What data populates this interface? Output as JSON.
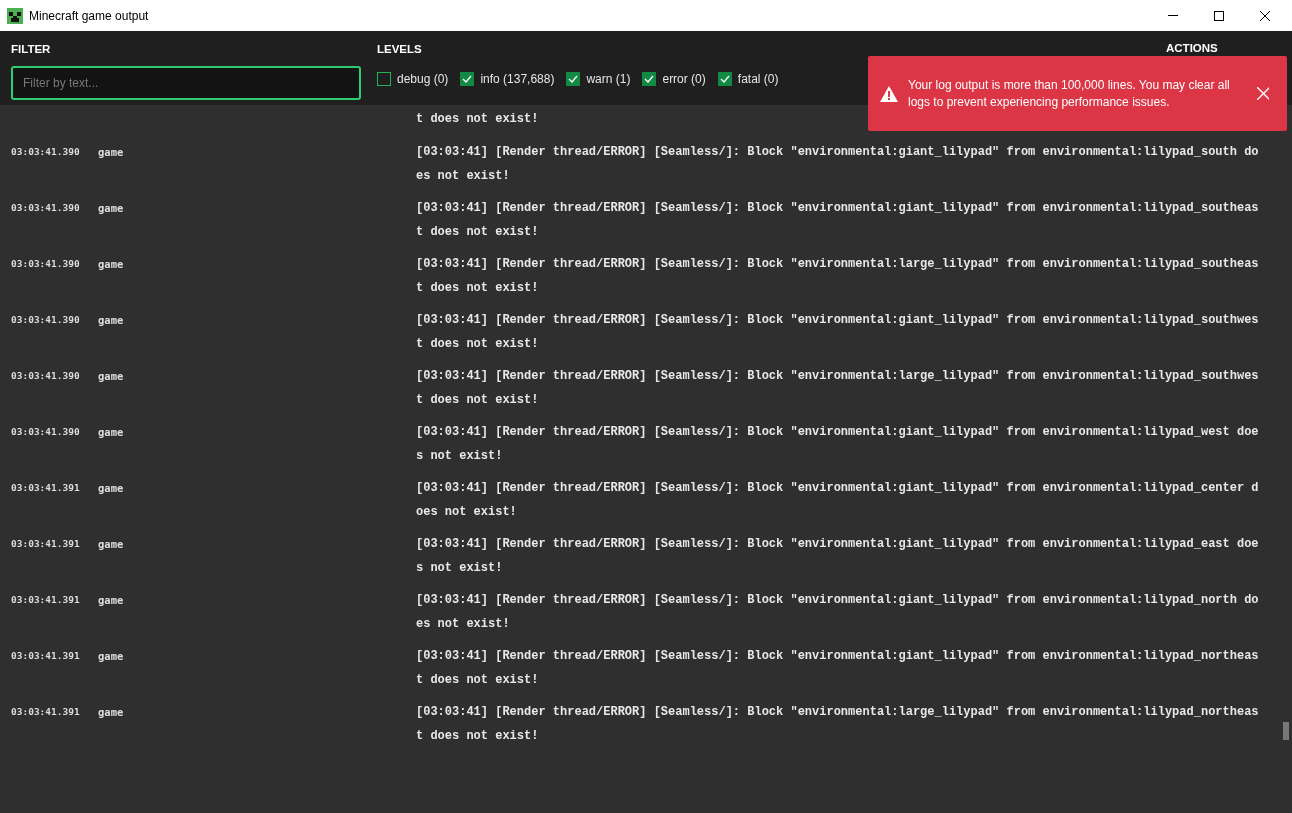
{
  "window": {
    "title": "Minecraft game output"
  },
  "filter": {
    "label": "FILTER",
    "placeholder": "Filter by text..."
  },
  "levels": {
    "label": "LEVELS",
    "items": [
      {
        "label": "debug (0)",
        "checked": false
      },
      {
        "label": "info (137,688)",
        "checked": true
      },
      {
        "label": "warn (1)",
        "checked": true
      },
      {
        "label": "error (0)",
        "checked": true
      },
      {
        "label": "fatal (0)",
        "checked": true
      }
    ]
  },
  "actions": {
    "label": "ACTIONS"
  },
  "alert": {
    "message": "Your log output is more than 100,000 lines. You may clear all logs to prevent experiencing performance issues."
  },
  "log_rows": [
    {
      "message": "t does not exist!"
    },
    {
      "time": "03:03:41.390",
      "source": "game",
      "message": "[03:03:41] [Render thread/ERROR] [Seamless/]: Block \"environmental:giant_lilypad\" from environmental:lilypad_south does not exist!"
    },
    {
      "time": "03:03:41.390",
      "source": "game",
      "message": "[03:03:41] [Render thread/ERROR] [Seamless/]: Block \"environmental:giant_lilypad\" from environmental:lilypad_southeast does not exist!"
    },
    {
      "time": "03:03:41.390",
      "source": "game",
      "message": "[03:03:41] [Render thread/ERROR] [Seamless/]: Block \"environmental:large_lilypad\" from environmental:lilypad_southeast does not exist!"
    },
    {
      "time": "03:03:41.390",
      "source": "game",
      "message": "[03:03:41] [Render thread/ERROR] [Seamless/]: Block \"environmental:giant_lilypad\" from environmental:lilypad_southwest does not exist!"
    },
    {
      "time": "03:03:41.390",
      "source": "game",
      "message": "[03:03:41] [Render thread/ERROR] [Seamless/]: Block \"environmental:large_lilypad\" from environmental:lilypad_southwest does not exist!"
    },
    {
      "time": "03:03:41.390",
      "source": "game",
      "message": "[03:03:41] [Render thread/ERROR] [Seamless/]: Block \"environmental:giant_lilypad\" from environmental:lilypad_west does not exist!"
    },
    {
      "time": "03:03:41.391",
      "source": "game",
      "message": "[03:03:41] [Render thread/ERROR] [Seamless/]: Block \"environmental:giant_lilypad\" from environmental:lilypad_center does not exist!"
    },
    {
      "time": "03:03:41.391",
      "source": "game",
      "message": "[03:03:41] [Render thread/ERROR] [Seamless/]: Block \"environmental:giant_lilypad\" from environmental:lilypad_east does not exist!"
    },
    {
      "time": "03:03:41.391",
      "source": "game",
      "message": "[03:03:41] [Render thread/ERROR] [Seamless/]: Block \"environmental:giant_lilypad\" from environmental:lilypad_north does not exist!"
    },
    {
      "time": "03:03:41.391",
      "source": "game",
      "message": "[03:03:41] [Render thread/ERROR] [Seamless/]: Block \"environmental:giant_lilypad\" from environmental:lilypad_northeast does not exist!"
    },
    {
      "time": "03:03:41.391",
      "source": "game",
      "message": "[03:03:41] [Render thread/ERROR] [Seamless/]: Block \"environmental:large_lilypad\" from environmental:lilypad_northeast does not exist!"
    }
  ]
}
